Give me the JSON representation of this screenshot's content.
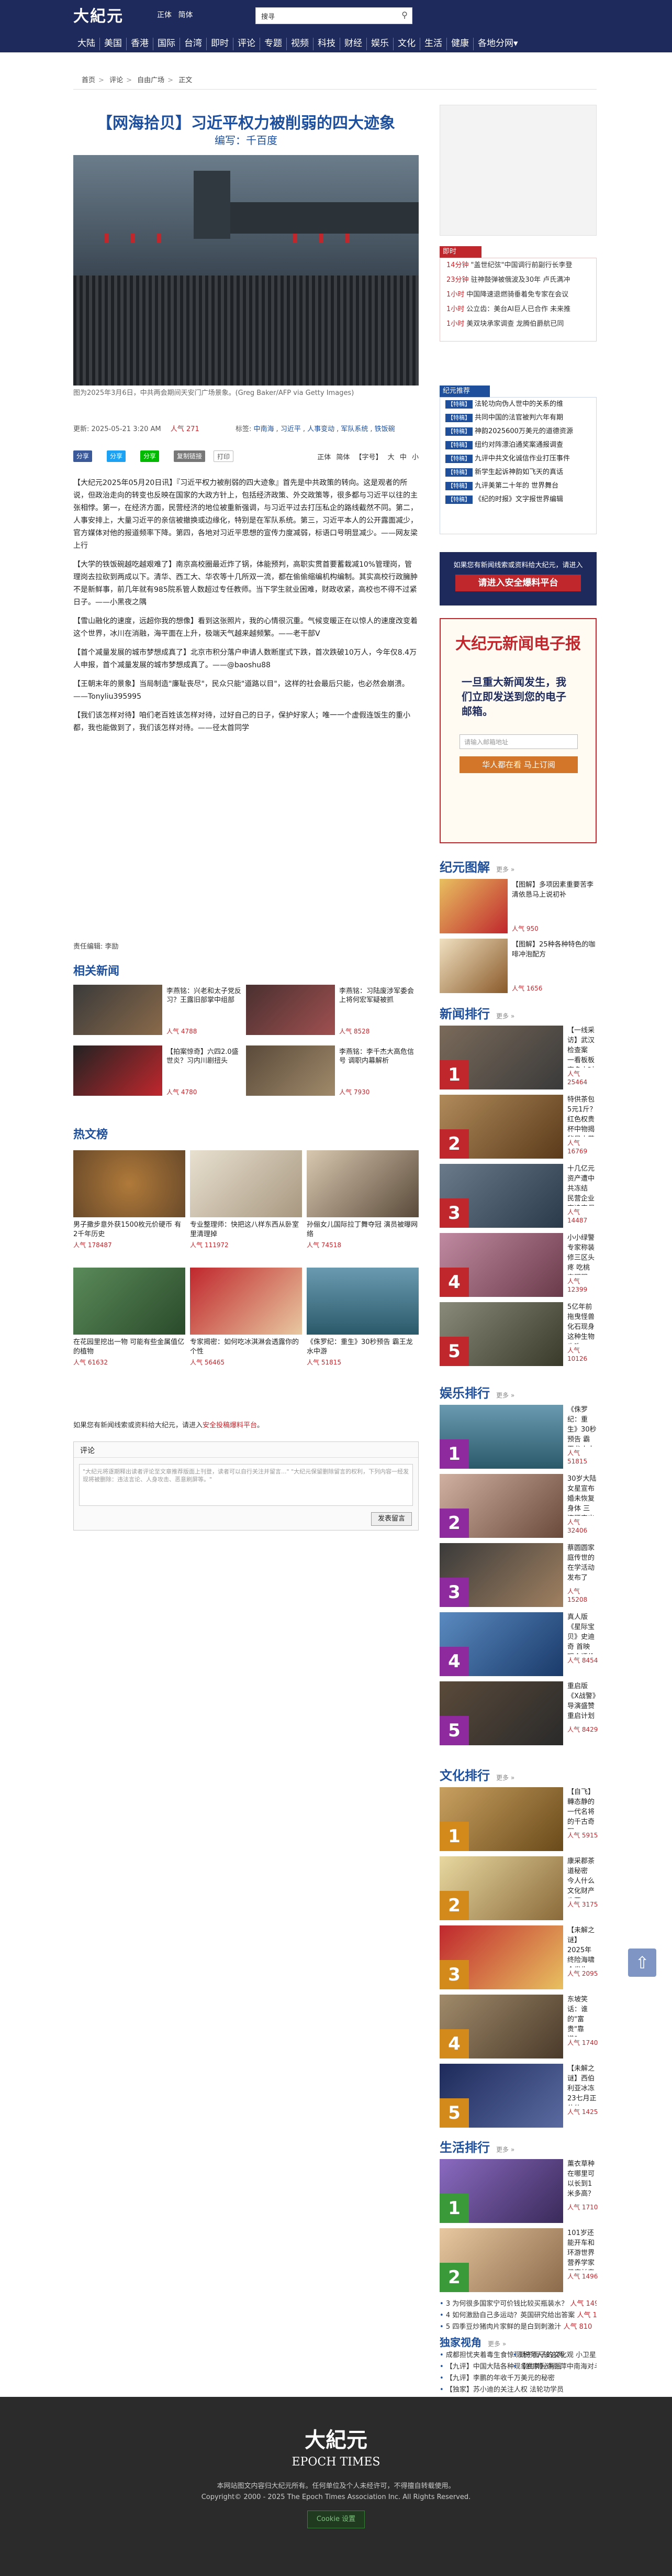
{
  "header": {
    "logo": "大紀元",
    "langs": [
      "正体",
      "简体"
    ],
    "search_placeholder": "搜寻",
    "nav": [
      "大陆",
      "美国",
      "香港",
      "国际",
      "台湾",
      "即时",
      "评论",
      "专题",
      "视频",
      "科技",
      "财经",
      "娱乐",
      "文化",
      "生活",
      "健康",
      "各地分网▾"
    ]
  },
  "breadcrumb": [
    "首页",
    "评论",
    "自由广场",
    "正文"
  ],
  "article": {
    "title": "【网海拾贝】习近平权力被削弱的四大迹象",
    "author": "编写：千百度",
    "caption": "图为2025年3月6日，中共两会期间天安门广场景象。(Greg Baker/AFP via Getty Images)",
    "updated": "更新: 2025-05-21 3:20 AM",
    "popularity": "人气 271",
    "tags_label": "标签:",
    "tags": [
      "中南海",
      "习近平",
      "人事变动",
      "军队系统",
      "铁饭碗"
    ],
    "share": [
      "分享",
      "分享",
      "分享",
      "复制链接",
      "打印"
    ],
    "font_controls": [
      "正体",
      "简体",
      "【字号】",
      "大",
      "中",
      "小"
    ],
    "paragraphs": [
      "【大纪元2025年05月20日讯】『习近平权力被削弱的四大迹象』首先是中共政策的转向。这是观者的所说，但政治走向的转变也反映在国家的大政方针上，包括经济政策、外交政策等，很多都与习近平以往的主张相悖。第一，在经济方面，民营经济的地位被重新强调，与习近平过去打压私企的路线截然不同。第二，人事安排上，大量习近平的亲信被撤换或边缘化，特别是在军队系统。第三，习近平本人的公开露面减少，官方媒体对他的报道频率下降。第四，各地对习近平思想的宣传力度减弱，标语口号明显减少。——网友梁上行",
      "【大学的铁饭碗越吃越艰难了】南京高校圈最近炸了锅，体能预判，高职实贯首要蓄栽减10%管理岗，管理岗去拉砍到两成以下。清华、西工大、华农等十几所双一流，都在偷偷缩编机构编制。其实高校行政臃肿不是新鲜事，前几年就有985院系管人数超过专任教师。当下学生就业困难，财政收紧，高校也不得不过紧日子。——小黑夜之隅",
      "【雪山融化的速度，远超你我的想像】看到这张照片，我的心情很沉重。气候变暖正在以惊人的速度改变着这个世界，冰川在消融，海平面在上升，极端天气越来越频繁。——老干部Ⅴ",
      "【首个减量发展的城市梦想成真了】北京市积分落户申请人数断崖式下跌，首次跌破10万人，今年仅8.4万人申报，首个减量发展的城市梦想成真了。——@baoshu88",
      "【王朝末年的景象】当局制造\"廉耻丧尽\"，民众只能\"道路以目\"，这样的社会最后只能，也必然会崩溃。——Tonyliu395995",
      "【我们该怎样对待】咱们老百姓该怎样对待，过好自己的日子，保护好家人；唯一一个虚假连饭生的重小都，我也能做到了，我们该怎样对待。——径太首同学"
    ],
    "editor": "责任编辑: 李励"
  },
  "related": {
    "title": "相关新闻",
    "items": [
      {
        "title": "李燕铭：兴老和太子党反习？王露旧部掌中组部",
        "views": "人气 4788"
      },
      {
        "title": "李燕铭：习陆废涉军委会 上将何宏军疑被抓",
        "views": "人气 8528"
      },
      {
        "title": "【拍案惊奇】六四2.0盛世炎？习内川剧扭头",
        "views": "人气 4780"
      },
      {
        "title": "李燕铭：李千杰大高危信号 调职内幕解析",
        "views": "人气 7930"
      }
    ]
  },
  "hotlist": {
    "title": "热文榜",
    "items": [
      {
        "title": "男子撒步意外获1500枚元价硬币 有2千年历史",
        "views": "人气 178487"
      },
      {
        "title": "专业整理师：快把这八样东西从卧室里清理掉",
        "views": "人气 111972"
      },
      {
        "title": "孙俪女儿国际拉丁舞夺冠 演员被曝网络",
        "views": "人气 74518"
      },
      {
        "title": "在花园里挖出一物 可能有些金属值亿的植物",
        "views": "人气 61632"
      },
      {
        "title": "专家揭密：如何吃冰淇淋会透露你的个性",
        "views": "人气 56465"
      },
      {
        "title": "《侏罗纪：重生》30秒预告 霸王龙水中游",
        "views": "人气 51815"
      }
    ]
  },
  "comments": {
    "notice": "如果您有新闻线索或资料给大纪元，请进入",
    "notice_link": "安全投稿爆料平台",
    "header": "评论",
    "placeholder": "\"大纪元将逐期释出读者评论至文章推荐版面上刊登，读者可以自行关注并留言...\"\n\"大纪元保留删除留言的权利，下列内容一经发现将被删除：违法言论、人身攻击、恶意刷屏等。\"",
    "post": "发表留言"
  },
  "sidebar": {
    "breaking_label": "即时",
    "breaking": [
      {
        "time": "14分钟",
        "text": "\"盖世纪弦\"中国调行前副行长李登"
      },
      {
        "time": "23分钟",
        "text": "驻神鼓弹被俄波及30年 卢氏满冲"
      },
      {
        "time": "1小时",
        "text": "中国降速退燃骑垂着免专家在会议"
      },
      {
        "time": "1小时",
        "text": "公立齿：美台AI巨人已合作 未来推"
      },
      {
        "time": "1小时",
        "text": "美双块承家调查 龙腾伯爵航已同"
      }
    ],
    "special_label": "纪元推荐",
    "special": [
      {
        "tag": "【特稿】",
        "text": "法轮功向伪人世中的关系的维"
      },
      {
        "tag": "【特稿】",
        "text": "共同中国的法官被判六年有期"
      },
      {
        "tag": "【特稿】",
        "text": "神韵2025600万美元的道德资源"
      },
      {
        "tag": "【特稿】",
        "text": "纽约对阵漂泊通奖案通报调查"
      },
      {
        "tag": "【特稿】",
        "text": "九评中共文化诚信作业打压事件"
      },
      {
        "tag": "【特稿】",
        "text": "新学生起诉神韵如飞天的真话"
      },
      {
        "tag": "【特稿】",
        "text": "九评美第二十年的 世界舞台"
      },
      {
        "tag": "【特稿】",
        "text": "《纪的时报》文字报世界编辑"
      }
    ],
    "tip_text": "如果您有新闻线索或资料给大纪元，请进入",
    "tip_button": "请进入安全爆料平台",
    "epaper": {
      "title": "大纪元新闻电子报",
      "slogan": "一旦重大新闻发生，我们立即发送到您的电子邮箱。",
      "placeholder": "请输入邮箱地址",
      "button": "华人都在看 马上订阅"
    },
    "gallery_title": "纪元图解",
    "gallery": [
      {
        "title": "【图解】多项因素重要苦李清依恳马上说初补",
        "views": "人气 950"
      },
      {
        "title": "【图解】25种各种特色的咖啡冲泡配方",
        "views": "人气 1656"
      }
    ],
    "more": "更多 »",
    "news_rank_title": "新闻排行",
    "news_rank": [
      {
        "title": "【一线采访】武汉检查案 一看板板商多小时",
        "views": "人气 25464"
      },
      {
        "title": "特供茶包5元1斤？红色权贵杯中物揭秘早内幕",
        "views": "人气 16769"
      },
      {
        "title": "十几亿元资产遭中共冻结 民营企业家追索保命",
        "views": "人气 14487"
      },
      {
        "title": "小小绿警专家称装修三区头疼 吃桃定期服",
        "views": "人气 12399"
      },
      {
        "title": "5亿年前拖曳怪兽化石现身 这种生物也吃",
        "views": "人气 10126"
      }
    ],
    "ent_rank_title": "娱乐排行",
    "ent_rank": [
      {
        "title": "《侏罗纪：重生》30秒预告 霸王龙水中游",
        "views": "人气 51815"
      },
      {
        "title": "30岁大陆女星宣布婚未恢复身体 三连腰突出",
        "views": "人气 32406"
      },
      {
        "title": "蔡圆圆家庭传世的在学活动发布了",
        "views": "人气 15208"
      },
      {
        "title": "真人版《星际宝贝》史迪奇 首映 观众评价",
        "views": "人气 8454"
      },
      {
        "title": "重启版《X战警》导演盛赞 重启计划",
        "views": "人气 8429"
      }
    ],
    "culture_rank_title": "文化排行",
    "culture_rank": [
      {
        "title": "【自飞】轉态静的 一代名将的千古奇冤",
        "views": "人气 5915"
      },
      {
        "title": "康采郡茶道秘密 今人什么文化财产也要",
        "views": "人气 3175"
      },
      {
        "title": "【未解之谜】2025年终险海啸 会发生吗？",
        "views": "人气 2095"
      },
      {
        "title": "东坡笑话：谁的\"富贵\"靠谱？",
        "views": "人气 1740"
      },
      {
        "title": "【未解之谜】西伯利亚冰冻 23七月正位体",
        "views": "人气 1425"
      }
    ],
    "life_rank_title": "生活排行",
    "life_rank": [
      {
        "title": "薰衣草种在哪里可以长到1米多高？",
        "views": "人气 1710"
      },
      {
        "title": "101岁还能开车和环游世界 营养学家健康长寿秘诀",
        "views": "人气 1496"
      },
      {
        "title": "为何很多国家宁可价钱比较买瓶装水？",
        "views": "人气 1490"
      },
      {
        "title": "如何激励自己多运动？英国研究给出答案",
        "views": "人气 1478"
      },
      {
        "title": "四季豆炒猪肉片家鲜的是白到刺激汁",
        "views": "人气 810"
      }
    ],
    "exclusive_title": "独家视角",
    "exclusive": [
      "成都担忧夹着毒生食惊现 税务人该这两",
      "【九评】中国大陆各种现象的神秘背后",
      "【九评】李鹏的年收千万美元的秘密",
      "【独家】苏小迪的关注人权 法轮功学员",
      "勤于面子的文化观 小卫星成为新的窗口",
      "【独家】许丽萍中南海对斗争事件"
    ]
  },
  "footer": {
    "logo": "大紀元",
    "logo_en": "EPOCH TIMES",
    "copy1": "本网站图文内容归大纪元所有。任何单位及个人未经许可，不得擅自转载使用。",
    "copy2": "Copyright© 2000 - 2025  The Epoch Times Association Inc. All Rights Reserved.",
    "badge": "Cookie 设置"
  },
  "colors": {
    "brand": "#1d2a5b",
    "accent": "#c0272d",
    "link": "#1d4f9c"
  }
}
